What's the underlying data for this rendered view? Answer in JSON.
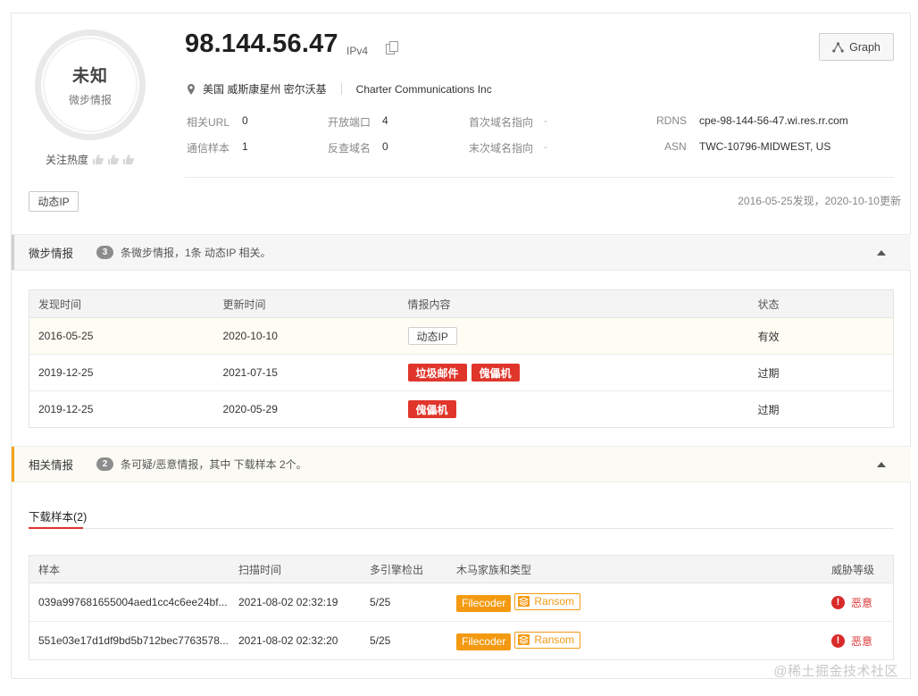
{
  "header": {
    "verdict": "未知",
    "verdict_sub": "微步情报",
    "heat_label": "关注热度",
    "ip": "98.144.56.47",
    "ip_type": "IPv4",
    "graph_button": "Graph",
    "location": "美国 威斯康星州 密尔沃基",
    "org": "Charter Communications Inc",
    "fields": {
      "url_label": "相关URL",
      "url_value": "0",
      "ports_label": "开放端口",
      "ports_value": "4",
      "first_domain_label": "首次域名指向",
      "first_domain_value": "-",
      "rdns_label": "RDNS",
      "rdns_value": "cpe-98-144-56-47.wi.res.rr.com",
      "samples_label": "通信样本",
      "samples_value": "1",
      "reverse_label": "反查域名",
      "reverse_value": "0",
      "last_domain_label": "末次域名指向",
      "last_domain_value": "-",
      "asn_label": "ASN",
      "asn_value": "TWC-10796-MIDWEST, US"
    },
    "tag": "动态IP",
    "dates": "2016-05-25发现，2020-10-10更新"
  },
  "intel_section": {
    "title": "微步情报",
    "count": "3",
    "desc": "条微步情报，1条 动态IP 相关。",
    "columns": [
      "发现时间",
      "更新时间",
      "情报内容",
      "状态"
    ],
    "rows": [
      {
        "found": "2016-05-25",
        "updated": "2020-10-10",
        "tags": [
          "动态IP"
        ],
        "status": "有效"
      },
      {
        "found": "2019-12-25",
        "updated": "2021-07-15",
        "tags": [
          "垃圾邮件",
          "傀儡机"
        ],
        "status": "过期"
      },
      {
        "found": "2019-12-25",
        "updated": "2020-05-29",
        "tags": [
          "傀儡机"
        ],
        "status": "过期"
      }
    ]
  },
  "related_section": {
    "title": "相关情报",
    "count": "2",
    "desc": "条可疑/恶意情报，其中 下载样本 2个。",
    "tab": "下载样本(2)",
    "columns": [
      "样本",
      "扫描时间",
      "多引擎检出",
      "木马家族和类型",
      "威胁等级"
    ],
    "rows": [
      {
        "hash": "039a997681655004aed1cc4c6ee24bf...",
        "scan": "2021-08-02 02:32:19",
        "detect": "5/25",
        "family": "Filecoder",
        "type": "Ransom",
        "level": "恶意"
      },
      {
        "hash": "551e03e17d1df9bd5b712bec7763578...",
        "scan": "2021-08-02 02:32:20",
        "detect": "5/25",
        "family": "Filecoder",
        "type": "Ransom",
        "level": "恶意"
      }
    ]
  },
  "watermark": "@稀土掘金技术社区",
  "colors": {
    "accent_red": "#e0352b",
    "orange": "#f39a12",
    "valid_green": "#3aa04b"
  }
}
